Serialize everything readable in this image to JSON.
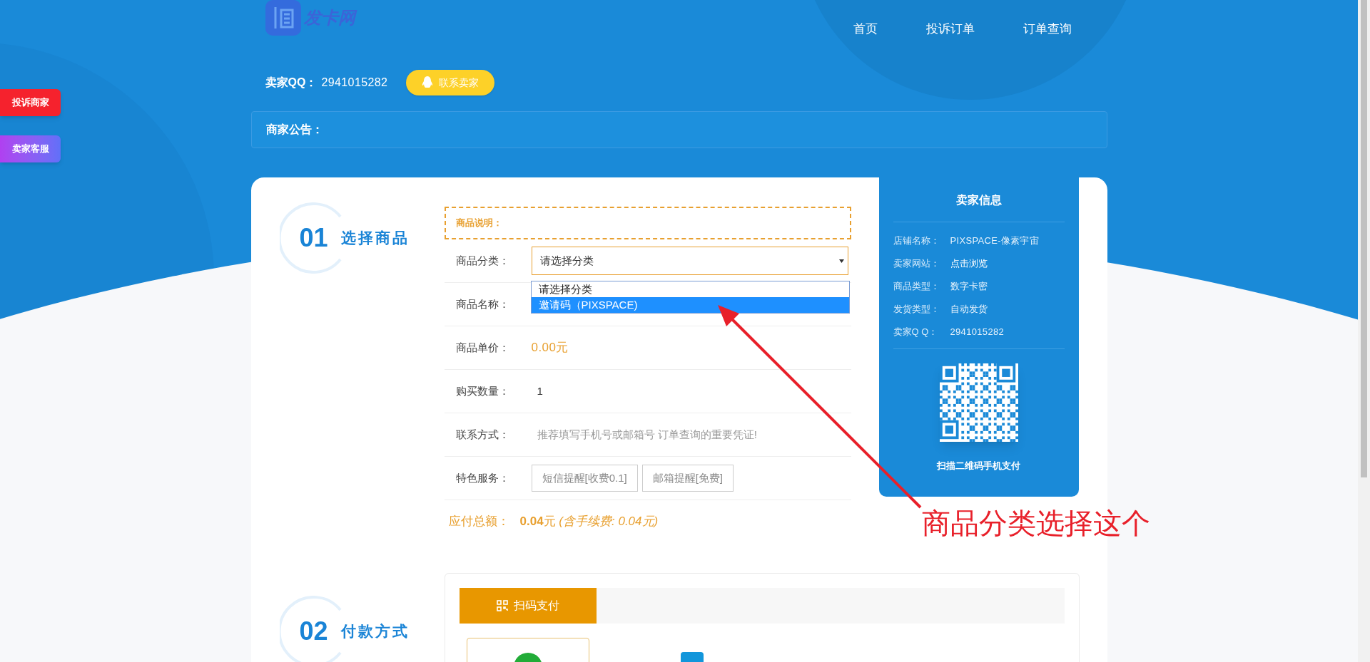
{
  "logo": {
    "text": "发卡网"
  },
  "nav": [
    {
      "label": "首页"
    },
    {
      "label": "投诉订单"
    },
    {
      "label": "订单查询"
    }
  ],
  "seller_qq": {
    "label": "卖家QQ：",
    "value": "2941015282"
  },
  "contact_button": {
    "label": "联系卖家"
  },
  "side_buttons": [
    {
      "label": "投诉商家",
      "kind": "complaint"
    },
    {
      "label": "卖家客服",
      "kind": "service"
    }
  ],
  "notice": {
    "label": "商家公告："
  },
  "step1": {
    "number": "01",
    "title": "选择商品"
  },
  "description": {
    "label": "商品说明："
  },
  "form": {
    "category": {
      "label": "商品分类：",
      "value": "请选择分类",
      "expanded": true,
      "options": [
        {
          "label": "请选择分类",
          "highlighted": false
        },
        {
          "label": "邀请码（PIXSPACE)",
          "highlighted": true
        }
      ]
    },
    "name": {
      "label": "商品名称："
    },
    "price": {
      "label": "商品单价：",
      "value": "0.00元"
    },
    "quantity": {
      "label": "购买数量：",
      "value": "1"
    },
    "contact": {
      "label": "联系方式：",
      "placeholder": "推荐填写手机号或邮箱号 订单查询的重要凭证!"
    },
    "services": {
      "label": "特色服务：",
      "options": [
        {
          "label": "短信提醒[收费0.1]"
        },
        {
          "label": "邮箱提醒[免费]"
        }
      ]
    },
    "total": {
      "label": "应付总额：",
      "value": "**0.04**元 *(含手续费: 0.04元)*"
    }
  },
  "seller_info": {
    "title": "卖家信息",
    "rows": [
      {
        "label": "店铺名称：",
        "value": "PIXSPACE-像素宇宙",
        "kind": "text"
      },
      {
        "label": "卖家网站：",
        "value": "点击浏览",
        "kind": "link"
      },
      {
        "label": "商品类型：",
        "value": "数字卡密",
        "kind": "text"
      },
      {
        "label": "发货类型：",
        "value": "自动发货",
        "kind": "text"
      },
      {
        "label": "卖家Q Q：",
        "value": "2941015282",
        "kind": "text"
      }
    ],
    "caption": "扫描二维码手机支付"
  },
  "step2": {
    "number": "02",
    "title": "付款方式"
  },
  "payment_tabs": [
    {
      "label": "扫码支付",
      "selected": true
    }
  ],
  "payment_options": [
    {
      "kind": "wechat",
      "selected": true
    },
    {
      "kind": "alipay",
      "selected": false
    }
  ],
  "annotation": {
    "text": "商品分类选择这个"
  }
}
